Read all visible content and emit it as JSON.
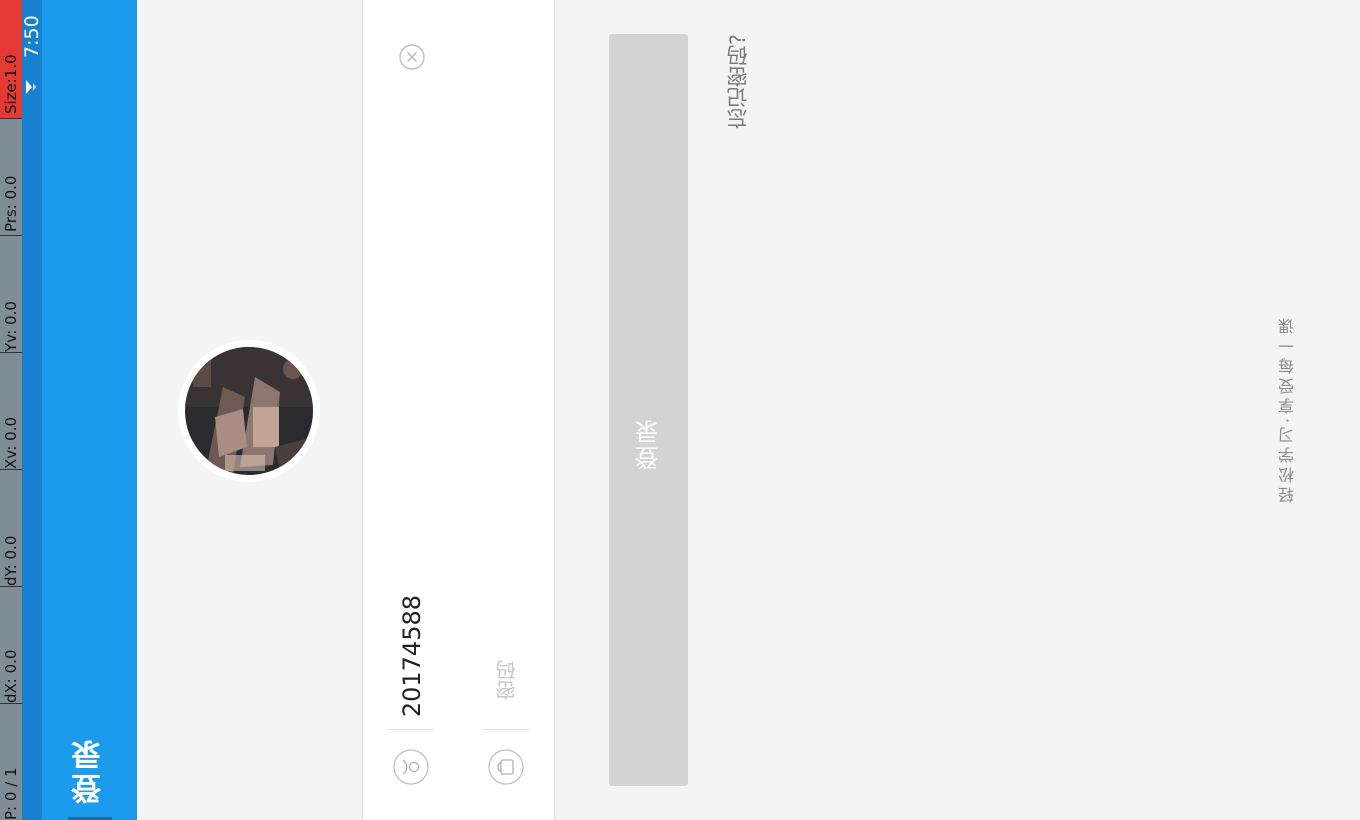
{
  "debug_overlay": {
    "size": "Size:1.0",
    "prs": "Prs: 0.0",
    "yv": "Yv: 0.0",
    "xv": "Xv: 0.0",
    "dy": "dY: 0.0",
    "dx": "dX: 0.0",
    "pointer": "P: 0 / 1"
  },
  "status_bar": {
    "time": "7:50",
    "icons": [
      "wifi-icon"
    ]
  },
  "app_bar": {
    "title": "登录"
  },
  "login_form": {
    "avatar": "avatar-image",
    "username_icon": "user-icon",
    "username_value": "20174588",
    "clear_icon": "close-circle-icon",
    "password_icon": "lock-icon",
    "password_placeholder": "密码",
    "login_button_label": "登录",
    "forgot_password_link": "忘记密码?"
  },
  "slogan": "轻松学习·享受每一课",
  "colors": {
    "app_bar": "#1c9aeb",
    "status_bar": "#1780cf",
    "login_button_disabled": "#d3d3d3"
  }
}
